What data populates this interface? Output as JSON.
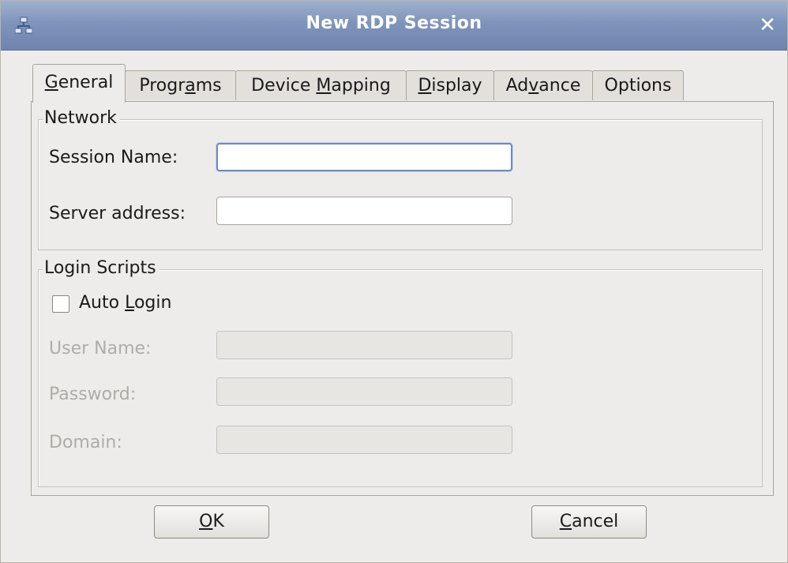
{
  "window": {
    "title": "New RDP Session",
    "close_glyph": "✕",
    "icon": "network-icon",
    "titlebar_color": "#7f94bb"
  },
  "tabs": [
    {
      "pre": "",
      "mnemonic": "G",
      "post": "eneral",
      "active": true
    },
    {
      "pre": "Progr",
      "mnemonic": "a",
      "post": "ms",
      "active": false
    },
    {
      "pre": "Device ",
      "mnemonic": "M",
      "post": "apping",
      "active": false
    },
    {
      "pre": "",
      "mnemonic": "D",
      "post": "isplay",
      "active": false
    },
    {
      "pre": "Ad",
      "mnemonic": "v",
      "post": "ance",
      "active": false
    },
    {
      "pre": "Options",
      "mnemonic": "",
      "post": "",
      "active": false
    }
  ],
  "network": {
    "legend": "Network",
    "session_name_label": "Session Name:",
    "session_name_value": "",
    "server_address_label": "Server address:",
    "server_address_value": ""
  },
  "login": {
    "legend": "Login Scripts",
    "auto_login_pre": "Auto ",
    "auto_login_mnemonic": "L",
    "auto_login_post": "ogin",
    "auto_login_checked": false,
    "user_name_label": "User Name:",
    "user_name_value": "",
    "password_label": "Password:",
    "password_value": "",
    "domain_label": "Domain:",
    "domain_value": ""
  },
  "buttons": {
    "ok_mnemonic": "O",
    "ok_post": "K",
    "cancel_mnemonic": "C",
    "cancel_post": "ancel"
  }
}
